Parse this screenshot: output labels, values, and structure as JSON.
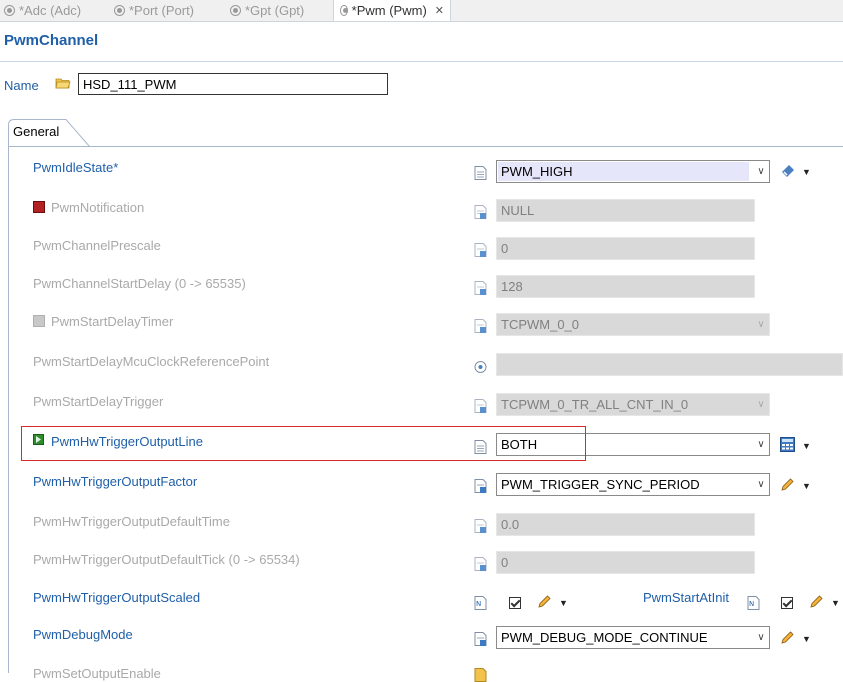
{
  "tabs": [
    {
      "label": "*Adc (Adc)"
    },
    {
      "label": "*Port (Port)"
    },
    {
      "label": "*Gpt (Gpt)"
    },
    {
      "label": "*Pwm (Pwm)",
      "close": "✕"
    }
  ],
  "header": {
    "title": "PwmChannel"
  },
  "name": {
    "label": "Name",
    "value": "HSD_111_PWM"
  },
  "general_tab": {
    "label": "General"
  },
  "rows": [
    {
      "label": "PwmIdleState*",
      "value": "PWM_HIGH",
      "enabled": true
    },
    {
      "label": "PwmNotification",
      "value": "NULL",
      "enabled": false
    },
    {
      "label": "PwmChannelPrescale",
      "value": "0",
      "enabled": false
    },
    {
      "label": "PwmChannelStartDelay (0 -> 65535)",
      "value": "128",
      "enabled": false
    },
    {
      "label": "PwmStartDelayTimer",
      "value": "TCPWM_0_0",
      "enabled": false
    },
    {
      "label": "PwmStartDelayMcuClockReferencePoint",
      "value": "",
      "enabled": false
    },
    {
      "label": "PwmStartDelayTrigger",
      "value": "TCPWM_0_TR_ALL_CNT_IN_0",
      "enabled": false
    },
    {
      "label": "PwmHwTriggerOutputLine",
      "value": "BOTH",
      "enabled": true
    },
    {
      "label": "PwmHwTriggerOutputFactor",
      "value": "PWM_TRIGGER_SYNC_PERIOD",
      "enabled": true
    },
    {
      "label": "PwmHwTriggerOutputDefaultTime",
      "value": "0.0",
      "enabled": false
    },
    {
      "label": "PwmHwTriggerOutputDefaultTick (0 -> 65534)",
      "value": "0",
      "enabled": false
    },
    {
      "label": "PwmHwTriggerOutputScaled",
      "enabled": true,
      "checked": true
    },
    {
      "label": "PwmStartAtInit",
      "enabled": true,
      "checked": true
    },
    {
      "label": "PwmDebugMode",
      "value": "PWM_DEBUG_MODE_CONTINUE",
      "enabled": true
    },
    {
      "label": "PwmSetOutputEnable",
      "enabled": false
    }
  ],
  "colors": {
    "accent": "#1f5fa8",
    "disabled_text": "#a9a9a9",
    "disabled_field": "#d9d9d9",
    "highlight_box": "#d9292a",
    "selected_text_bg": "#e6e6fa"
  },
  "icons": [
    "tab-module-icon",
    "folder-icon",
    "document-icon",
    "link-icon",
    "calculator-icon",
    "pencil-icon",
    "wrench-icon",
    "chevron-down-icon"
  ]
}
